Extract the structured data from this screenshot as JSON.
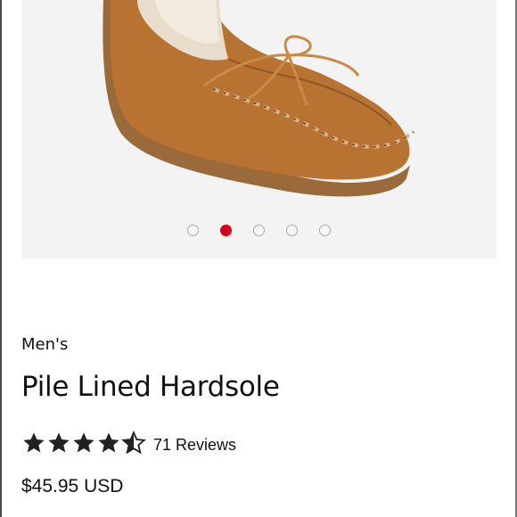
{
  "product": {
    "category": "Men's",
    "title": "Pile Lined Hardsole",
    "rating": 4.5,
    "rating_max": 5,
    "reviews": "71 Reviews",
    "price": "$45.95 USD"
  },
  "gallery": {
    "image": "moccasin-slipper",
    "slide_count": 5,
    "active_slide": 2
  },
  "colors": {
    "accent_dot": "#d6001c",
    "star": "#222222"
  }
}
